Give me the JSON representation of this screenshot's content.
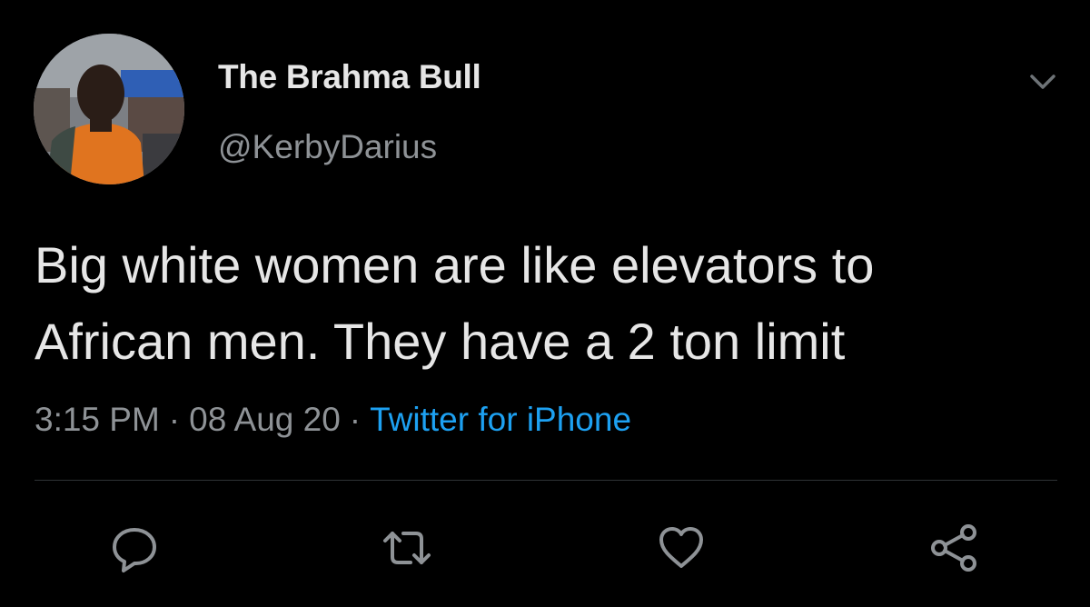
{
  "author": {
    "display_name": "The Brahma Bull",
    "handle": "@KerbyDarius",
    "avatar_icon": "profile-photo"
  },
  "tweet": {
    "text_lines": [
      "Big white women are like elevators to",
      "African men. They have a 2 ton limit"
    ],
    "time": "3:15 PM",
    "date": "08 Aug 20",
    "source": "Twitter for iPhone",
    "separator": "·"
  },
  "actions": {
    "reply_icon": "comment-icon",
    "retweet_icon": "retweet-icon",
    "like_icon": "heart-icon",
    "share_icon": "share-icon"
  },
  "colors": {
    "background": "#000000",
    "text_primary": "#e6e6e6",
    "text_secondary": "#8e9296",
    "accent": "#1da1f2",
    "divider": "#2f3336"
  }
}
